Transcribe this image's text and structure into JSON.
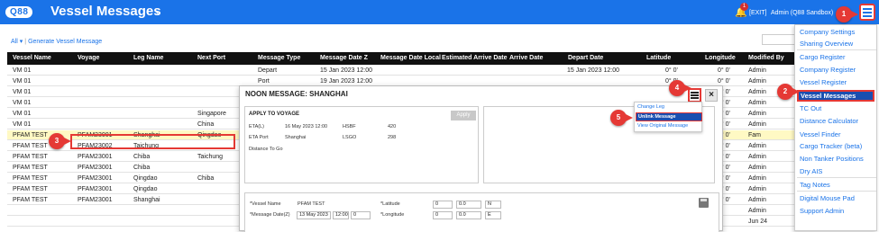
{
  "app": {
    "logo": "Q88",
    "title": "Vessel Messages",
    "notification_count": "1",
    "exit_label": "[EXIT]",
    "user_label": "Admin (Q88 Sandbox)"
  },
  "steps": [
    "1",
    "2",
    "3",
    "4",
    "5"
  ],
  "subbar": {
    "filter_label": "All",
    "generate_link": "Generate Vessel Message"
  },
  "grid": {
    "headers": [
      "Vessel Name",
      "Voyage",
      "Leg Name",
      "Next Port",
      "Message Type",
      "Message Date Z",
      "Message Date Local",
      "Estimated Arrive Date",
      "Arrive Date",
      "Depart Date",
      "Latitude",
      "Longitude",
      "Modified By"
    ],
    "rows": [
      [
        "VM 01",
        "",
        "",
        "",
        "Depart",
        "15 Jan 2023 12:00",
        "",
        "15 Jan 2023 12:00",
        "0° 0'",
        "0° 0'",
        "Admin"
      ],
      [
        "VM 01",
        "",
        "",
        "",
        "Port",
        "19 Jan 2023 12:00",
        "",
        "",
        "0° 0'",
        "0° 0'",
        "Admin"
      ],
      [
        "VM 01",
        "",
        "",
        "",
        "",
        "",
        "",
        "",
        "0° 0'",
        "0° 0'",
        "Admin"
      ],
      [
        "VM 01",
        "",
        "",
        "",
        "",
        "",
        "",
        "",
        "0° 0'",
        "0° 0'",
        "Admin"
      ],
      [
        "VM 01",
        "",
        "",
        "Singapore",
        "",
        "",
        "",
        "",
        "0° 0'",
        "0° 0'",
        "Admin"
      ],
      [
        "VM 01",
        "",
        "",
        "China",
        "",
        "",
        "",
        "",
        "0° 0'",
        "0° 0'",
        "Admin"
      ],
      [
        "PFAM TEST",
        "PFAM23001",
        "Shanghai",
        "Qingdao",
        "",
        "",
        "",
        "",
        "0° 0'",
        "0° 0'",
        "Fam"
      ],
      [
        "PFAM TEST",
        "PFAM23002",
        "Taichung",
        "",
        "",
        "",
        "",
        "",
        "0° 0'",
        "0° 0'",
        "Admin"
      ],
      [
        "PFAM TEST",
        "PFAM23001",
        "Chiba",
        "Taichung",
        "",
        "",
        "",
        "",
        "0° 0'",
        "0° 0'",
        "Admin"
      ],
      [
        "PFAM TEST",
        "PFAM23001",
        "Chiba",
        "",
        "",
        "",
        "",
        "",
        "0° 0'",
        "0° 0'",
        "Admin"
      ],
      [
        "PFAM TEST",
        "PFAM23001",
        "Qingdao",
        "Chiba",
        "",
        "",
        "",
        "",
        "0° 0'",
        "0° 0'",
        "Admin"
      ],
      [
        "PFAM TEST",
        "PFAM23001",
        "Qingdao",
        "",
        "",
        "",
        "",
        "",
        "0° 0'",
        "0° 0'",
        "Admin"
      ],
      [
        "PFAM TEST",
        "PFAM23001",
        "Shanghai",
        "",
        "",
        "",
        "",
        "",
        "0° 0'",
        "0° 0'",
        "Admin"
      ],
      [
        "",
        "",
        "",
        "",
        "",
        "",
        "",
        "",
        "",
        "",
        "Admin"
      ],
      [
        "",
        "",
        "",
        "",
        "",
        "",
        "",
        "",
        "",
        "",
        "Jun 24"
      ]
    ]
  },
  "modal": {
    "title": "NOON MESSAGE: SHANGHAI",
    "apply_panel_title": "APPLY TO VOYAGE",
    "apply_button": "Apply",
    "eta_label": "ETA(L)",
    "eta_value": "16 May 2023 12:00",
    "eta_key": "HSBF",
    "eta_num": "420",
    "etaport_label": "ETA Port",
    "etaport_value": "Shanghai",
    "etaport_key": "LSGO",
    "etaport_num": "298",
    "dtg_label": "Distance To Go",
    "menu_items": [
      "Change Leg",
      "Unlink Message",
      "View Original Message"
    ],
    "form": {
      "vessel_label": "*Vessel Name",
      "vessel_value": "PFAM TEST",
      "msgdate_label": "*Message Date(Z)",
      "msgdate_value": "13 May 2023",
      "msgtime_value": "12:00",
      "lat_label": "*Latitude",
      "lon_label": "*Longitude",
      "lat_deg": "0",
      "lat_min": "0.0",
      "lat_dir": "N",
      "lon_deg": "0",
      "lon_min": "0.0",
      "lon_dir": "E",
      "tz_value": "0"
    }
  },
  "menu": {
    "items": [
      "Company Settings",
      "Sharing Overview",
      "Cargo Register",
      "Company Register",
      "Vessel Register",
      "Vessel Messages",
      "TC Out",
      "Distance Calculator",
      "Vessel Finder",
      "Cargo Tracker (beta)",
      "Non Tanker Positions",
      "Dry AIS",
      "Tag Notes",
      "Digital Mouse Pad",
      "Support Admin"
    ]
  }
}
